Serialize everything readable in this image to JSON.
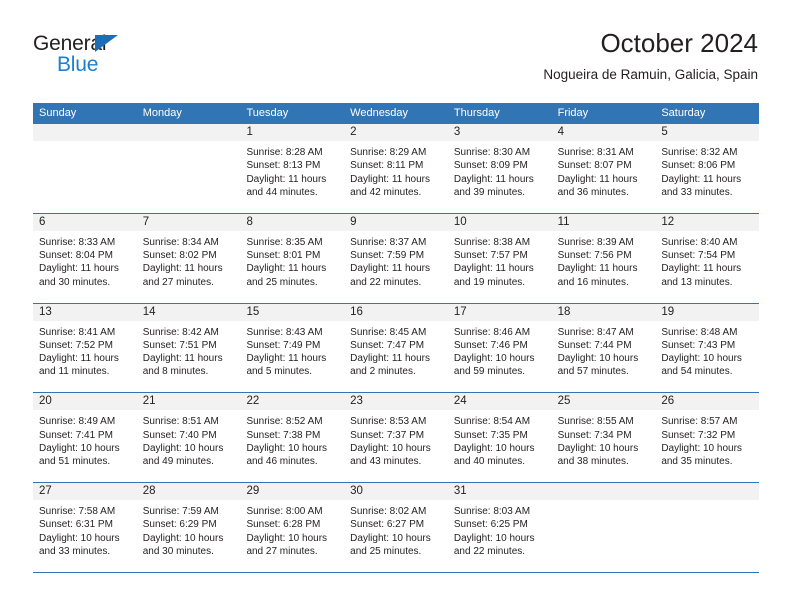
{
  "brand": {
    "name_part1": "General",
    "name_part2": "Blue",
    "logo_icon": "triangle-flag-icon",
    "accent_color": "#1c7fd0",
    "header_color": "#3175b4"
  },
  "header": {
    "title": "October 2024",
    "subtitle": "Nogueira de Ramuin, Galicia, Spain"
  },
  "calendar": {
    "weekdays": [
      "Sunday",
      "Monday",
      "Tuesday",
      "Wednesday",
      "Thursday",
      "Friday",
      "Saturday"
    ],
    "weeks": [
      [
        {
          "day": "",
          "sunrise": "",
          "sunset": "",
          "daylight1": "",
          "daylight2": ""
        },
        {
          "day": "",
          "sunrise": "",
          "sunset": "",
          "daylight1": "",
          "daylight2": ""
        },
        {
          "day": "1",
          "sunrise": "Sunrise: 8:28 AM",
          "sunset": "Sunset: 8:13 PM",
          "daylight1": "Daylight: 11 hours",
          "daylight2": "and 44 minutes."
        },
        {
          "day": "2",
          "sunrise": "Sunrise: 8:29 AM",
          "sunset": "Sunset: 8:11 PM",
          "daylight1": "Daylight: 11 hours",
          "daylight2": "and 42 minutes."
        },
        {
          "day": "3",
          "sunrise": "Sunrise: 8:30 AM",
          "sunset": "Sunset: 8:09 PM",
          "daylight1": "Daylight: 11 hours",
          "daylight2": "and 39 minutes."
        },
        {
          "day": "4",
          "sunrise": "Sunrise: 8:31 AM",
          "sunset": "Sunset: 8:07 PM",
          "daylight1": "Daylight: 11 hours",
          "daylight2": "and 36 minutes."
        },
        {
          "day": "5",
          "sunrise": "Sunrise: 8:32 AM",
          "sunset": "Sunset: 8:06 PM",
          "daylight1": "Daylight: 11 hours",
          "daylight2": "and 33 minutes."
        }
      ],
      [
        {
          "day": "6",
          "sunrise": "Sunrise: 8:33 AM",
          "sunset": "Sunset: 8:04 PM",
          "daylight1": "Daylight: 11 hours",
          "daylight2": "and 30 minutes."
        },
        {
          "day": "7",
          "sunrise": "Sunrise: 8:34 AM",
          "sunset": "Sunset: 8:02 PM",
          "daylight1": "Daylight: 11 hours",
          "daylight2": "and 27 minutes."
        },
        {
          "day": "8",
          "sunrise": "Sunrise: 8:35 AM",
          "sunset": "Sunset: 8:01 PM",
          "daylight1": "Daylight: 11 hours",
          "daylight2": "and 25 minutes."
        },
        {
          "day": "9",
          "sunrise": "Sunrise: 8:37 AM",
          "sunset": "Sunset: 7:59 PM",
          "daylight1": "Daylight: 11 hours",
          "daylight2": "and 22 minutes."
        },
        {
          "day": "10",
          "sunrise": "Sunrise: 8:38 AM",
          "sunset": "Sunset: 7:57 PM",
          "daylight1": "Daylight: 11 hours",
          "daylight2": "and 19 minutes."
        },
        {
          "day": "11",
          "sunrise": "Sunrise: 8:39 AM",
          "sunset": "Sunset: 7:56 PM",
          "daylight1": "Daylight: 11 hours",
          "daylight2": "and 16 minutes."
        },
        {
          "day": "12",
          "sunrise": "Sunrise: 8:40 AM",
          "sunset": "Sunset: 7:54 PM",
          "daylight1": "Daylight: 11 hours",
          "daylight2": "and 13 minutes."
        }
      ],
      [
        {
          "day": "13",
          "sunrise": "Sunrise: 8:41 AM",
          "sunset": "Sunset: 7:52 PM",
          "daylight1": "Daylight: 11 hours",
          "daylight2": "and 11 minutes."
        },
        {
          "day": "14",
          "sunrise": "Sunrise: 8:42 AM",
          "sunset": "Sunset: 7:51 PM",
          "daylight1": "Daylight: 11 hours",
          "daylight2": "and 8 minutes."
        },
        {
          "day": "15",
          "sunrise": "Sunrise: 8:43 AM",
          "sunset": "Sunset: 7:49 PM",
          "daylight1": "Daylight: 11 hours",
          "daylight2": "and 5 minutes."
        },
        {
          "day": "16",
          "sunrise": "Sunrise: 8:45 AM",
          "sunset": "Sunset: 7:47 PM",
          "daylight1": "Daylight: 11 hours",
          "daylight2": "and 2 minutes."
        },
        {
          "day": "17",
          "sunrise": "Sunrise: 8:46 AM",
          "sunset": "Sunset: 7:46 PM",
          "daylight1": "Daylight: 10 hours",
          "daylight2": "and 59 minutes."
        },
        {
          "day": "18",
          "sunrise": "Sunrise: 8:47 AM",
          "sunset": "Sunset: 7:44 PM",
          "daylight1": "Daylight: 10 hours",
          "daylight2": "and 57 minutes."
        },
        {
          "day": "19",
          "sunrise": "Sunrise: 8:48 AM",
          "sunset": "Sunset: 7:43 PM",
          "daylight1": "Daylight: 10 hours",
          "daylight2": "and 54 minutes."
        }
      ],
      [
        {
          "day": "20",
          "sunrise": "Sunrise: 8:49 AM",
          "sunset": "Sunset: 7:41 PM",
          "daylight1": "Daylight: 10 hours",
          "daylight2": "and 51 minutes."
        },
        {
          "day": "21",
          "sunrise": "Sunrise: 8:51 AM",
          "sunset": "Sunset: 7:40 PM",
          "daylight1": "Daylight: 10 hours",
          "daylight2": "and 49 minutes."
        },
        {
          "day": "22",
          "sunrise": "Sunrise: 8:52 AM",
          "sunset": "Sunset: 7:38 PM",
          "daylight1": "Daylight: 10 hours",
          "daylight2": "and 46 minutes."
        },
        {
          "day": "23",
          "sunrise": "Sunrise: 8:53 AM",
          "sunset": "Sunset: 7:37 PM",
          "daylight1": "Daylight: 10 hours",
          "daylight2": "and 43 minutes."
        },
        {
          "day": "24",
          "sunrise": "Sunrise: 8:54 AM",
          "sunset": "Sunset: 7:35 PM",
          "daylight1": "Daylight: 10 hours",
          "daylight2": "and 40 minutes."
        },
        {
          "day": "25",
          "sunrise": "Sunrise: 8:55 AM",
          "sunset": "Sunset: 7:34 PM",
          "daylight1": "Daylight: 10 hours",
          "daylight2": "and 38 minutes."
        },
        {
          "day": "26",
          "sunrise": "Sunrise: 8:57 AM",
          "sunset": "Sunset: 7:32 PM",
          "daylight1": "Daylight: 10 hours",
          "daylight2": "and 35 minutes."
        }
      ],
      [
        {
          "day": "27",
          "sunrise": "Sunrise: 7:58 AM",
          "sunset": "Sunset: 6:31 PM",
          "daylight1": "Daylight: 10 hours",
          "daylight2": "and 33 minutes."
        },
        {
          "day": "28",
          "sunrise": "Sunrise: 7:59 AM",
          "sunset": "Sunset: 6:29 PM",
          "daylight1": "Daylight: 10 hours",
          "daylight2": "and 30 minutes."
        },
        {
          "day": "29",
          "sunrise": "Sunrise: 8:00 AM",
          "sunset": "Sunset: 6:28 PM",
          "daylight1": "Daylight: 10 hours",
          "daylight2": "and 27 minutes."
        },
        {
          "day": "30",
          "sunrise": "Sunrise: 8:02 AM",
          "sunset": "Sunset: 6:27 PM",
          "daylight1": "Daylight: 10 hours",
          "daylight2": "and 25 minutes."
        },
        {
          "day": "31",
          "sunrise": "Sunrise: 8:03 AM",
          "sunset": "Sunset: 6:25 PM",
          "daylight1": "Daylight: 10 hours",
          "daylight2": "and 22 minutes."
        },
        {
          "day": "",
          "sunrise": "",
          "sunset": "",
          "daylight1": "",
          "daylight2": ""
        },
        {
          "day": "",
          "sunrise": "",
          "sunset": "",
          "daylight1": "",
          "daylight2": ""
        }
      ]
    ]
  }
}
